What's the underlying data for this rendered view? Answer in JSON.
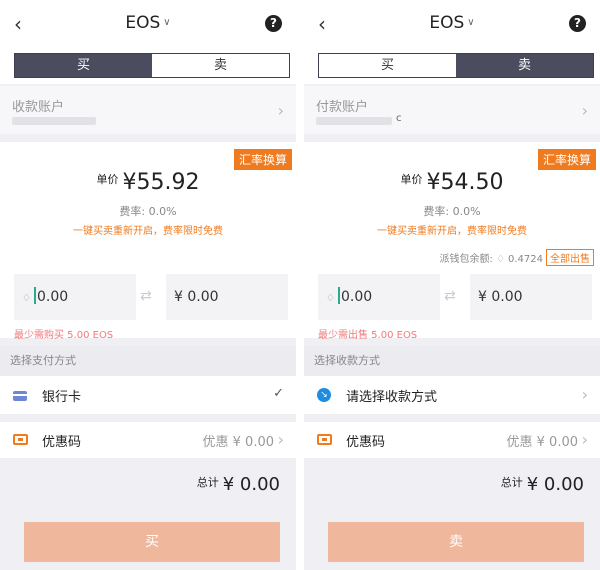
{
  "buy": {
    "header": {
      "back_icon": "back-arrow-icon",
      "title": "EOS",
      "title_chevron": "chevron-down-icon",
      "help_label": "?"
    },
    "tabs": [
      {
        "label": "买",
        "active": true
      },
      {
        "label": "卖",
        "active": false
      }
    ],
    "account": {
      "label": "收款账户"
    },
    "fx_badge": "汇率换算",
    "price": {
      "label": "单价",
      "value": "¥55.92"
    },
    "fee": "费率: 0.0%",
    "promo": "一键买卖重新开启，费率限时免费",
    "inputs": {
      "eos_value": "0.00",
      "cny_value": "¥ 0.00"
    },
    "min_message": "最少需购买 5.00 EOS",
    "section_label": "选择支付方式",
    "method": {
      "label": "银行卡",
      "icon": "card-icon",
      "selected": true
    },
    "coupon": {
      "label": "优惠码",
      "value": "优惠 ¥ 0.00"
    },
    "total": {
      "label": "总计",
      "value": "¥ 0.00"
    },
    "action_label": "买"
  },
  "sell": {
    "header": {
      "back_icon": "back-arrow-icon",
      "title": "EOS",
      "title_chevron": "chevron-down-icon",
      "help_label": "?"
    },
    "tabs": [
      {
        "label": "买",
        "active": false
      },
      {
        "label": "卖",
        "active": true
      }
    ],
    "account": {
      "label": "付款账户",
      "suffix": "c"
    },
    "fx_badge": "汇率换算",
    "price": {
      "label": "单价",
      "value": "¥54.50"
    },
    "fee": "费率: 0.0%",
    "promo": "一键买卖重新开启，费率限时免费",
    "balance": {
      "label": "派钱包余额:",
      "value": "0.4724",
      "sell_all": "全部出售"
    },
    "inputs": {
      "eos_value": "0.00",
      "cny_value": "¥ 0.00"
    },
    "min_message": "最少需出售 5.00 EOS",
    "section_label": "选择收款方式",
    "method": {
      "label": "请选择收款方式",
      "icon": "receive-method-icon",
      "selected": false
    },
    "coupon": {
      "label": "优惠码",
      "value": "优惠 ¥ 0.00"
    },
    "total": {
      "label": "总计",
      "value": "¥ 0.00"
    },
    "action_label": "卖"
  },
  "colors": {
    "accent": "#f07a1e",
    "tab_active": "#4b4d5e",
    "button_disabled": "#efb79b",
    "warning_text": "#f07a7a"
  }
}
